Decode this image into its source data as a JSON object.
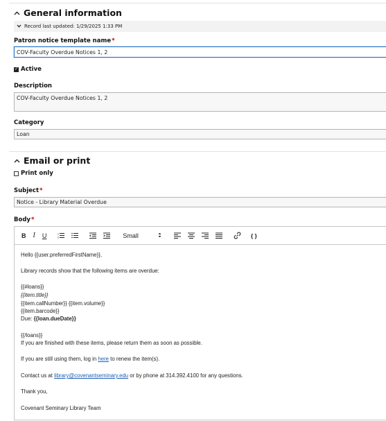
{
  "general": {
    "title": "General information",
    "updated": "Record last updated: 1/29/2025 1:33 PM",
    "name_label": "Patron notice template name",
    "name_value": "COV-Faculty Overdue Notices 1, 2",
    "active_label": "Active",
    "description_label": "Description",
    "description_value": "COV-Faculty Overdue Notices 1, 2",
    "category_label": "Category",
    "category_value": "Loan"
  },
  "email": {
    "title": "Email or print",
    "print_only_label": "Print only",
    "subject_label": "Subject",
    "subject_value": "Notice - Library Material Overdue",
    "body_label": "Body"
  },
  "required_mark": "*",
  "toolbar": {
    "bold": "B",
    "italic": "I",
    "underline": "U",
    "size_value": "Small",
    "code": "{ }"
  },
  "body": {
    "greeting": "Hello {{user.preferredFirstName}},",
    "intro": "Library records show that the following items are overdue:",
    "loans_open": "{{#loans}}",
    "item_title": "{{item.title}}",
    "item_call": "{{item.callNumber}} {{item.volume}}",
    "item_barcode": "{{item.barcode}}",
    "due_prefix": "Due: ",
    "due_value": "{{loan.dueDate}}",
    "loans_close": "{{/loans}}",
    "finished": "If you are finished with these items, please return them as soon as possible.",
    "still_prefix": "If you are still using them, log in ",
    "still_link": "here",
    "still_suffix": " to renew the item(s).",
    "contact_prefix": "Contact us at ",
    "contact_link": "library@covenantseminary.edu",
    "contact_suffix": " or by phone at 314.392.4100 for any questions.",
    "thanks": "Thank you,",
    "signature": "Covenant Seminary Library Team"
  }
}
